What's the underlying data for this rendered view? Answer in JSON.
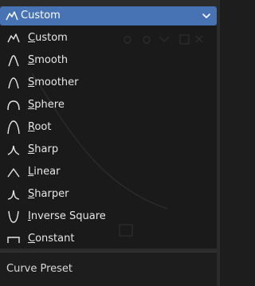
{
  "dropdown": {
    "selected_label": "Custom",
    "icon": "custom-curve-icon",
    "accent_color": "#4772b3"
  },
  "menu": {
    "items": [
      {
        "mnemonic": "C",
        "rest": "ustom",
        "icon": "custom-curve-icon"
      },
      {
        "mnemonic": "S",
        "rest": "mooth",
        "icon": "smooth-curve-icon"
      },
      {
        "mnemonic": "S",
        "rest": "moother",
        "icon": "smoother-curve-icon"
      },
      {
        "mnemonic": "S",
        "rest": "phere",
        "icon": "sphere-curve-icon"
      },
      {
        "mnemonic": "R",
        "rest": "oot",
        "icon": "root-curve-icon"
      },
      {
        "mnemonic": "S",
        "rest": "harp",
        "icon": "sharp-curve-icon"
      },
      {
        "mnemonic": "L",
        "rest": "inear",
        "icon": "linear-curve-icon"
      },
      {
        "mnemonic": "S",
        "rest": "harper",
        "icon": "sharper-curve-icon"
      },
      {
        "mnemonic": "I",
        "rest": "nverse Square",
        "icon": "inverse-square-curve-icon"
      },
      {
        "mnemonic": "C",
        "rest": "onstant",
        "icon": "constant-curve-icon"
      }
    ]
  },
  "footer": {
    "label": "Curve Preset"
  }
}
